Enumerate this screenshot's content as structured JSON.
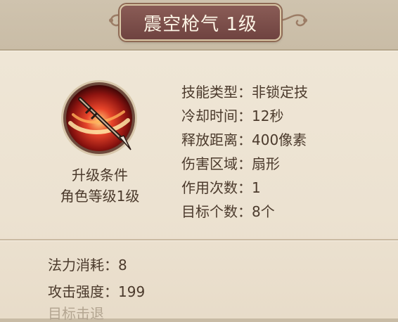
{
  "title": "震空枪气 1级",
  "upgrade": {
    "heading": "升级条件",
    "requirement": "角色等级1级"
  },
  "attributes": [
    {
      "label": "技能类型",
      "value": "非锁定技"
    },
    {
      "label": "冷却时间",
      "value": "12秒"
    },
    {
      "label": "释放距离",
      "value": "400像素"
    },
    {
      "label": "伤害区域",
      "value": "扇形"
    },
    {
      "label": "作用次数",
      "value": "1"
    },
    {
      "label": "目标个数",
      "value": "8个"
    }
  ],
  "separator": "：",
  "costs": [
    {
      "label": "法力消耗",
      "value": "8"
    },
    {
      "label": "攻击强度",
      "value": "199"
    }
  ],
  "truncated_line": "目标击退",
  "icons": {
    "skill": "spear-slash-icon"
  },
  "colors": {
    "banner": "#7a4d4a",
    "text": "#4b3a2c",
    "panel": "#ece2d1"
  }
}
